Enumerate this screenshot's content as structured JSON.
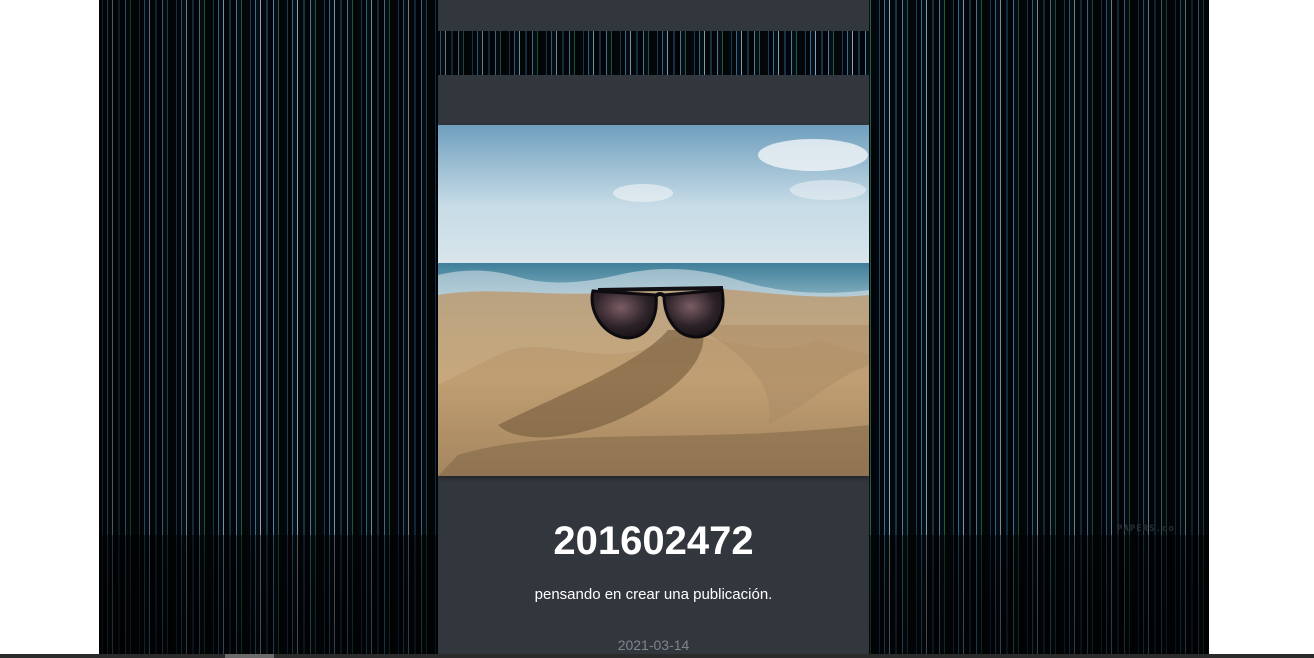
{
  "post": {
    "title": "201602472",
    "text": "pensando en crear una publicación.",
    "date": "2021-03-14",
    "image_icon": "sunglasses-on-beach-photo"
  },
  "background": {
    "watermark": "PAPERS.co"
  },
  "colors": {
    "card": "#32363d",
    "title_text": "#ffffff",
    "date_text": "#7f858d"
  }
}
